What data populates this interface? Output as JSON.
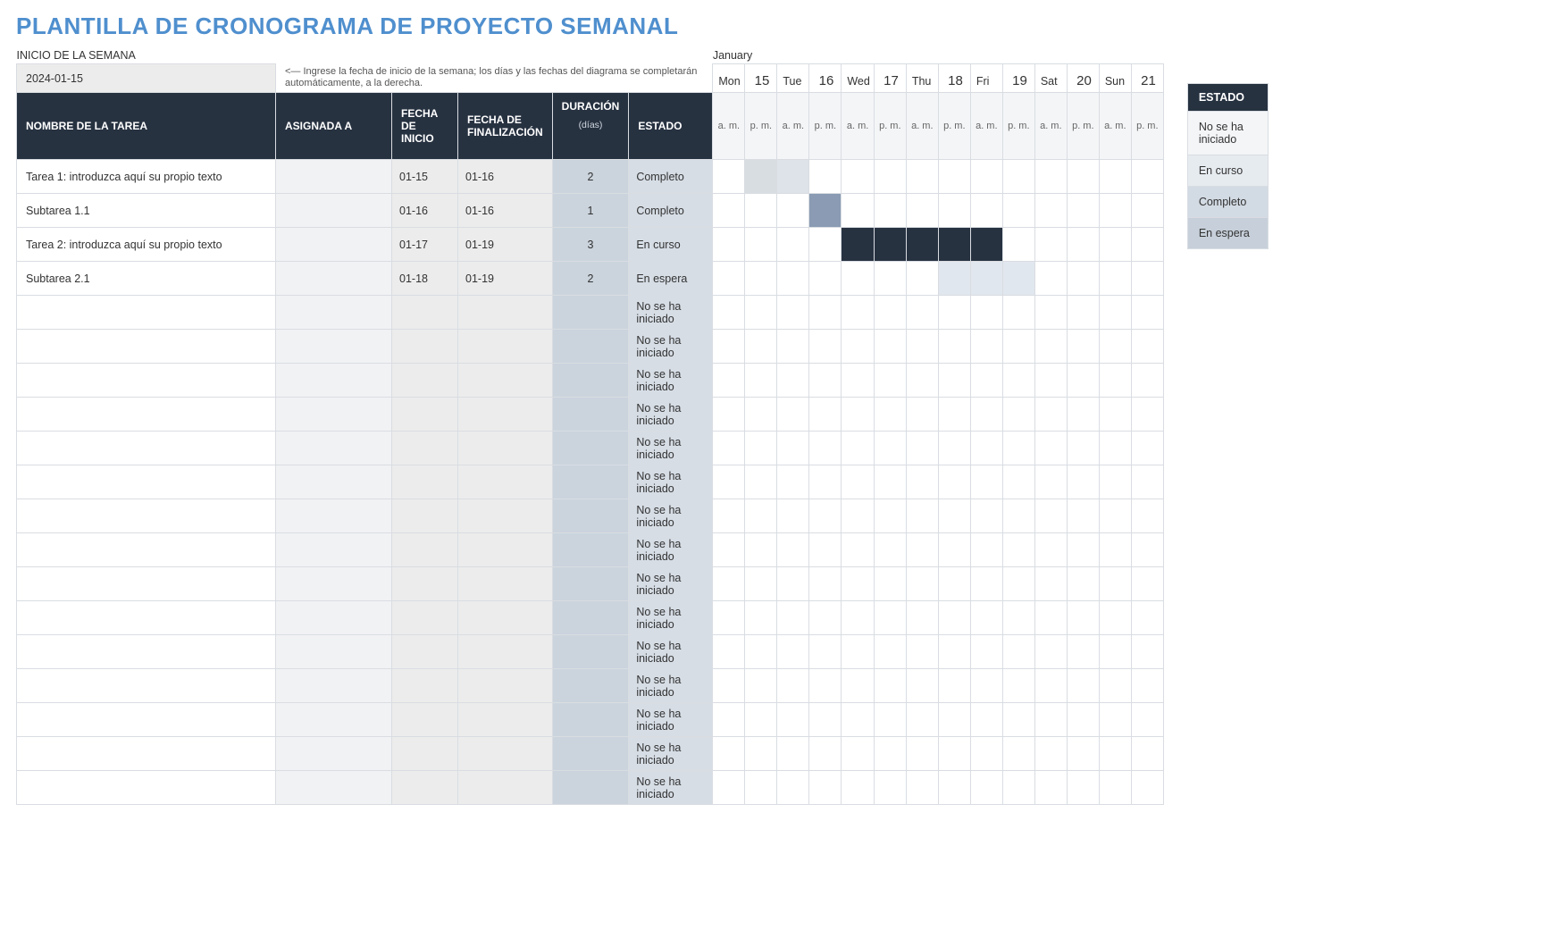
{
  "title": "PLANTILLA DE CRONOGRAMA DE PROYECTO SEMANAL",
  "week_start_label": "INICIO DE LA SEMANA",
  "week_start_value": "2024-01-15",
  "help_text": "<— Ingrese la fecha de inicio de la semana; los días y las fechas del diagrama se completarán automáticamente, a la derecha.",
  "month": "January",
  "days": [
    {
      "name": "Mon",
      "num": "15"
    },
    {
      "name": "Tue",
      "num": "16"
    },
    {
      "name": "Wed",
      "num": "17"
    },
    {
      "name": "Thu",
      "num": "18"
    },
    {
      "name": "Fri",
      "num": "19"
    },
    {
      "name": "Sat",
      "num": "20"
    },
    {
      "name": "Sun",
      "num": "21"
    }
  ],
  "am": "a. m.",
  "pm": "p. m.",
  "headers": {
    "task": "NOMBRE DE LA TAREA",
    "assigned": "ASIGNADA A",
    "start": "FECHA DE INICIO",
    "end": "FECHA DE FINALIZACIÓN",
    "duration": "DURACIÓN",
    "duration_sub": "(días)",
    "status": "ESTADO"
  },
  "status_default": "No se ha iniciado",
  "rows": [
    {
      "task": "Tarea 1: introduzca aquí su propio texto",
      "start": "01-15",
      "end": "01-16",
      "dur": "2",
      "status": "Completo",
      "bars": {
        "1": "bar-light1",
        "2": "bar-light2"
      }
    },
    {
      "task": "Subtarea 1.1",
      "start": "01-16",
      "end": "01-16",
      "dur": "1",
      "status": "Completo",
      "bars": {
        "3": "bar-steel"
      }
    },
    {
      "task": "Tarea 2: introduzca aquí su propio texto",
      "start": "01-17",
      "end": "01-19",
      "dur": "3",
      "status": "En curso",
      "bars": {
        "4": "bar-dark",
        "5": "bar-dark",
        "6": "bar-dark",
        "7": "bar-dark",
        "8": "bar-dark"
      }
    },
    {
      "task": "Subtarea 2.1",
      "start": "01-18",
      "end": "01-19",
      "dur": "2",
      "status": "En espera",
      "bars": {
        "7": "bar-pale",
        "8": "bar-pale",
        "9": "bar-pale"
      }
    },
    {},
    {},
    {},
    {},
    {},
    {},
    {},
    {},
    {},
    {},
    {},
    {},
    {},
    {},
    {}
  ],
  "legend": {
    "header": "ESTADO",
    "items": [
      {
        "label": "No se ha iniciado",
        "cls": "lg-ns"
      },
      {
        "label": "En curso",
        "cls": "lg-ec"
      },
      {
        "label": "Completo",
        "cls": "lg-co"
      },
      {
        "label": "En espera",
        "cls": "lg-ee"
      }
    ]
  }
}
